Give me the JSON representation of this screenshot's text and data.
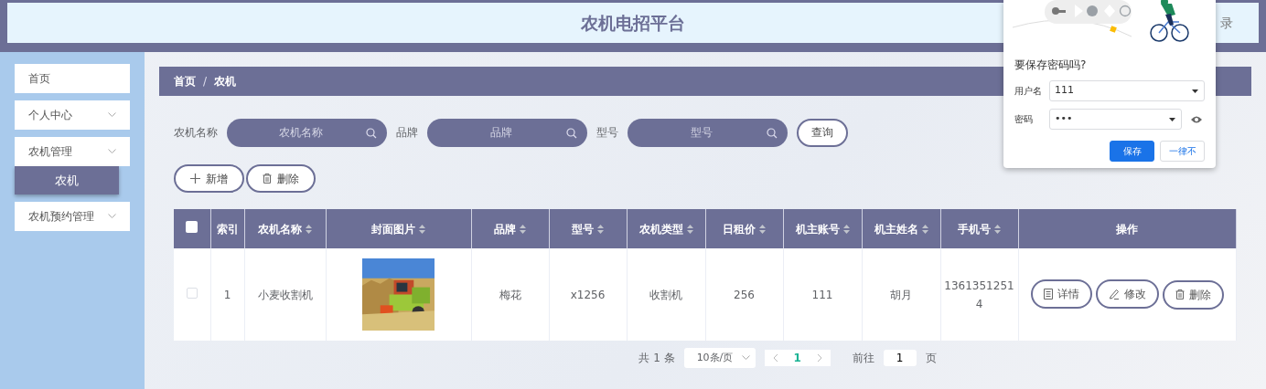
{
  "header": {
    "title": "农机电招平台",
    "login": "录"
  },
  "sidebar": {
    "items": [
      {
        "label": "首页",
        "expandable": false
      },
      {
        "label": "个人中心",
        "expandable": true
      },
      {
        "label": "农机管理",
        "expandable": true,
        "children": [
          {
            "label": "农机",
            "selected": true
          }
        ]
      },
      {
        "label": "农机预约管理",
        "expandable": true
      }
    ]
  },
  "breadcrumb": {
    "items": [
      "首页",
      "农机"
    ],
    "separator": "/"
  },
  "search": {
    "fields": [
      {
        "label": "农机名称",
        "placeholder": "农机名称"
      },
      {
        "label": "品牌",
        "placeholder": "品牌"
      },
      {
        "label": "型号",
        "placeholder": "型号"
      }
    ],
    "button": "查询"
  },
  "actions": [
    {
      "label": "新增",
      "kind": "add"
    },
    {
      "label": "删除",
      "kind": "delete"
    }
  ],
  "table": {
    "select_all_checked": false,
    "columns": [
      {
        "label": "索引",
        "sortable": false
      },
      {
        "label": "农机名称",
        "sortable": true
      },
      {
        "label": "封面图片",
        "sortable": true
      },
      {
        "label": "品牌",
        "sortable": true
      },
      {
        "label": "型号",
        "sortable": true
      },
      {
        "label": "农机类型",
        "sortable": true
      },
      {
        "label": "日租价",
        "sortable": true
      },
      {
        "label": "机主账号",
        "sortable": true
      },
      {
        "label": "机主姓名",
        "sortable": true
      },
      {
        "label": "手机号",
        "sortable": true
      },
      {
        "label": "操作",
        "sortable": false
      }
    ],
    "rows": [
      {
        "checked": false,
        "cells": [
          "1",
          "小麦收割机",
          {
            "kind": "picture"
          },
          "梅花",
          "x1256",
          "收割机",
          "256",
          "111",
          "胡月",
          "13613512514"
        ],
        "actions": [
          {
            "label": "详情",
            "kind": "detail"
          },
          {
            "label": "修改",
            "kind": "edit"
          },
          {
            "label": "删除",
            "kind": "delete"
          }
        ]
      }
    ]
  },
  "pagination": {
    "total": "共 1 条",
    "page_size": "10条/页",
    "pages": [
      {
        "label": "1",
        "selected": true
      }
    ],
    "goto_label": "前往",
    "goto_value": "1",
    "goto_unit": "页"
  },
  "password_popup": {
    "title": "要保存密码吗?",
    "fields": [
      {
        "label": "用户名",
        "value": "111",
        "reveal": false
      },
      {
        "label": "密码",
        "value": "•••",
        "reveal": true
      }
    ],
    "buttons": [
      {
        "label": "保存",
        "primary": true
      },
      {
        "label": "一律不",
        "primary": false
      }
    ]
  }
}
